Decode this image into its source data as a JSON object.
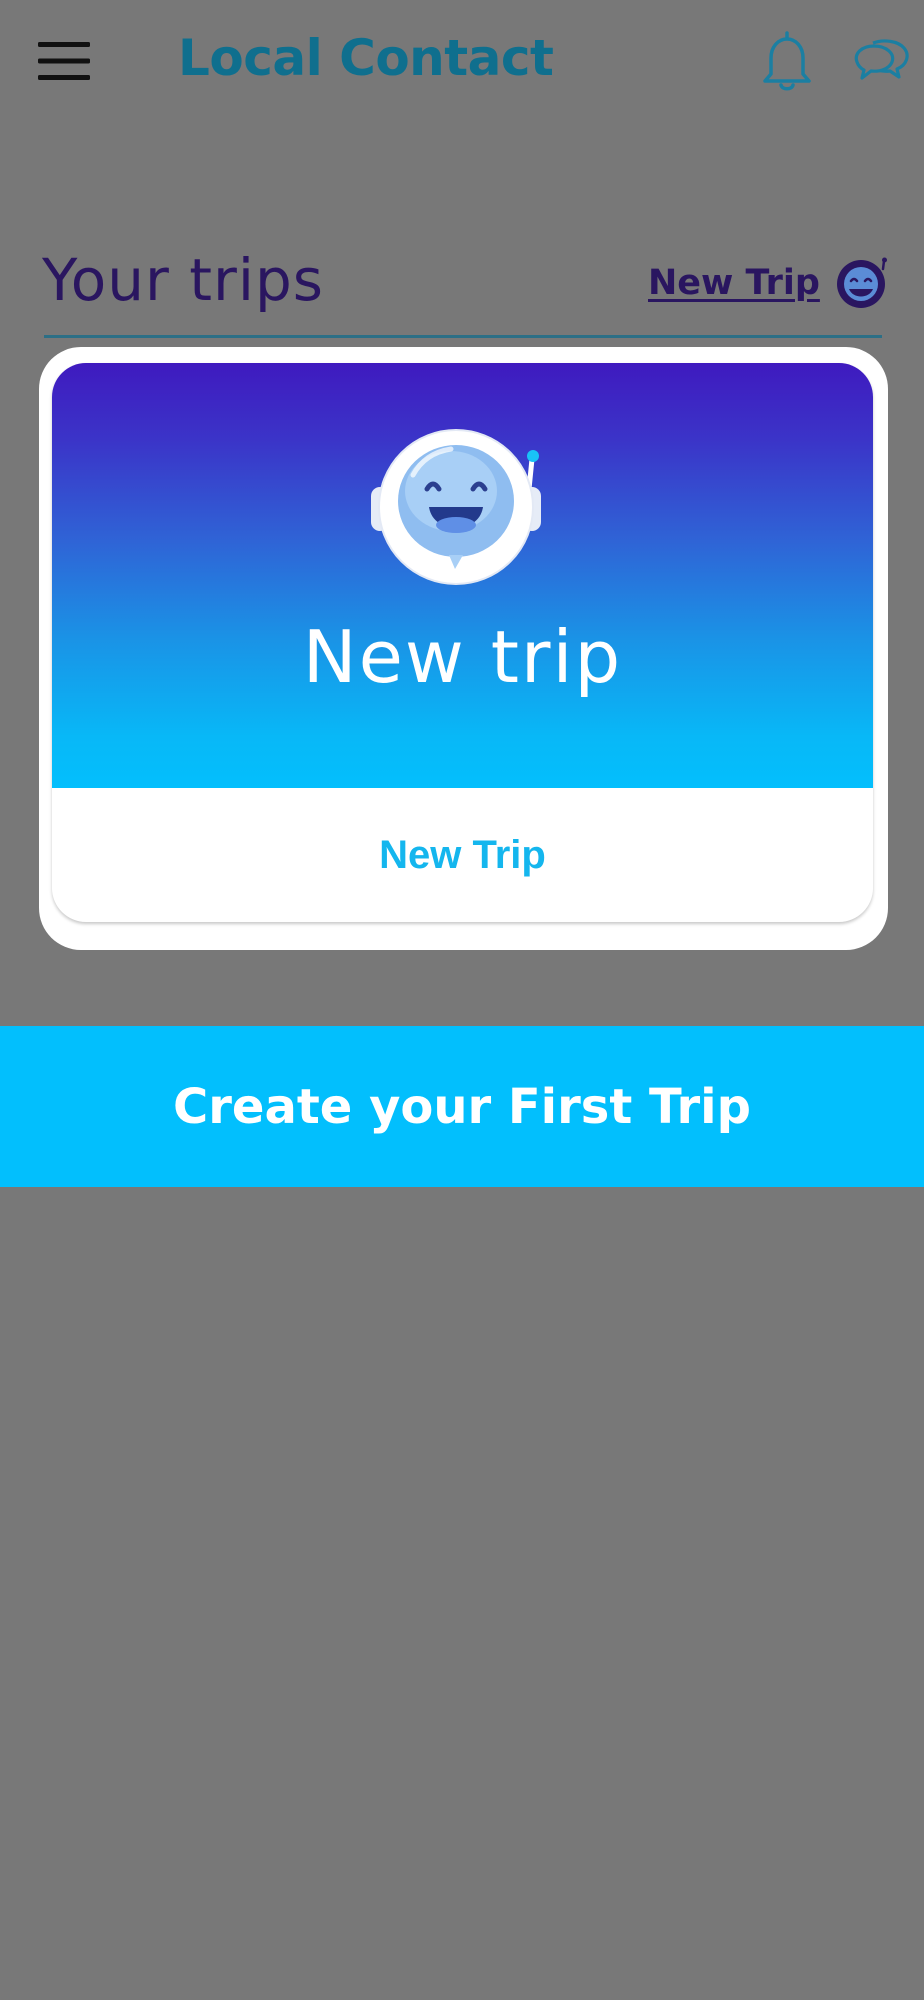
{
  "header": {
    "title": "Local Contact",
    "menu_icon": "hamburger-menu-icon",
    "notification_icon": "bell-icon",
    "messages_icon": "chat-bubbles-icon"
  },
  "trips_section": {
    "heading": "Your trips",
    "new_trip_link": "New Trip",
    "link_icon": "robot-avatar-icon"
  },
  "trip_card": {
    "image_title": "New trip",
    "caption": "New Trip",
    "illustration": "smiling-robot-astronaut-icon"
  },
  "cta": {
    "label": "Create your First Trip"
  },
  "colors": {
    "background": "#787878",
    "brand_title": "#0f6f8e",
    "heading": "#2a1660",
    "accent": "#02bffd",
    "card_gradient_top": "#3f1abf",
    "card_gradient_bottom": "#03bffd"
  }
}
